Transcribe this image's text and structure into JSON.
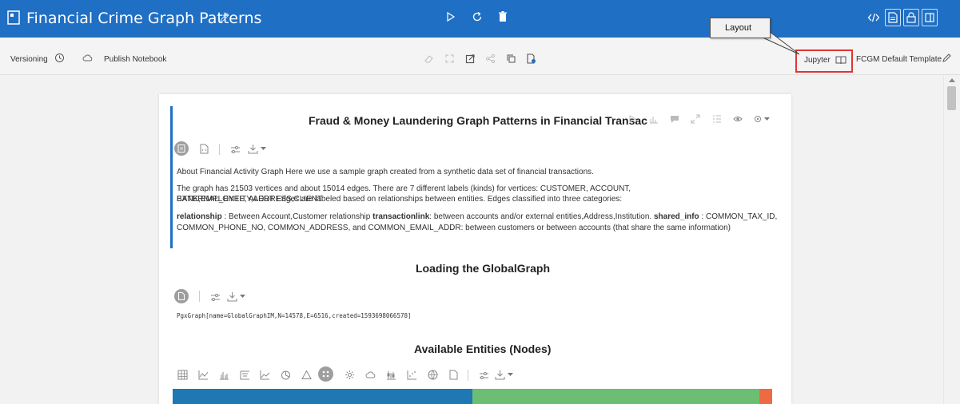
{
  "app": {
    "notebook_title": "Financial Crime Graph Patterns"
  },
  "toolbar": {
    "versioning_label": "Versioning",
    "publish_label": "Publish Notebook",
    "interpreter_label": "Jupyter",
    "template_label": "FCGM Default Template"
  },
  "callout": {
    "text": "Layout"
  },
  "paragraphs": {
    "intro": {
      "title": "Fraud & Money Laundering Graph Patterns in Financial Transac",
      "line1": "About Financial Activity Graph Here we use a sample graph created from a synthetic data set of financial transactions.",
      "line2a": "The graph has 21503 vertices and about 15014 edges. There are 7 different labels (kinds) for vertices: CUSTOMER, ACCOUNT, EXTERNAL_ENTITY,ADDRESS,CLIENT",
      "line2b": "BANK,EMPLOYEE, ALERT Edges are labeled based on relationships between entities. Edges classified into three categories:",
      "line3_b1": "relationship",
      "line3_t1": " : Between Account,Customer relationship ",
      "line3_b2": "transactionlink",
      "line3_t2": ": between accounts and/or external entities,Address,Institution. ",
      "line3_b3": "shared_info",
      "line3_t3": " : COMMON_TAX_ID,",
      "line3b": "COMMON_PHONE_NO, COMMON_ADDRESS, and COMMON_EMAIL_ADDR: between customers or between accounts (that share the same information)"
    },
    "loading": {
      "title": "Loading the GlobalGraph",
      "output": "PgxGraph[name=GlobalGraphIM,N=14578,E=6516,created=1593698066578]"
    },
    "entities": {
      "title": "Available Entities (Nodes)"
    }
  },
  "chart_data": {
    "type": "bar",
    "categories": [],
    "colors": [
      "#1f77b4",
      "#6cbf72",
      "#ee6a43"
    ],
    "values": [
      0.493,
      0.473,
      0.021
    ]
  },
  "colors": {
    "titlebar": "#1f6fc4",
    "highlight": "#e03434",
    "para_accent": "#1f6fc4"
  }
}
